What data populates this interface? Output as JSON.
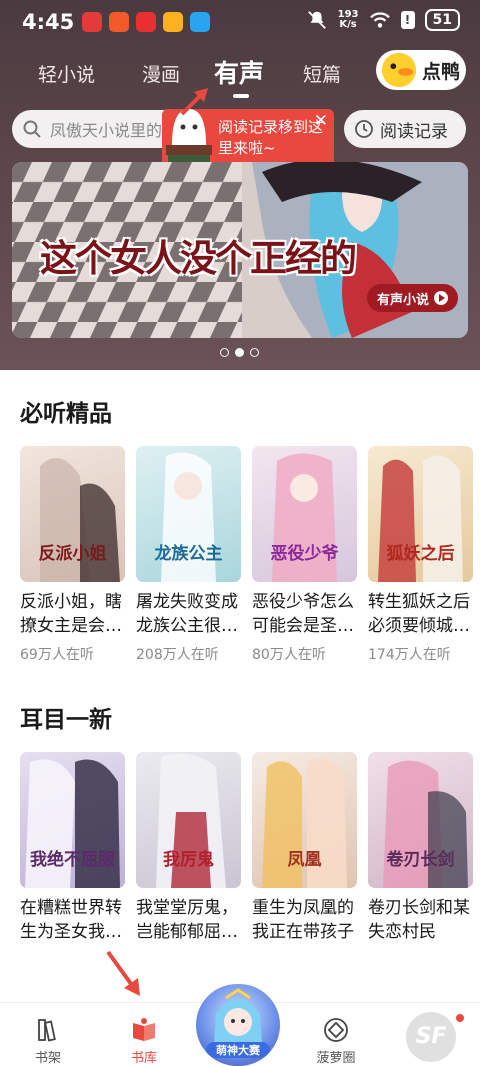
{
  "status_bar": {
    "time": "4:45",
    "net_speed_value": "193",
    "net_speed_unit": "K/s",
    "battery": "51"
  },
  "top_tabs": [
    {
      "label": "轻小说"
    },
    {
      "label": "漫画"
    },
    {
      "label": "有声",
      "active": true
    },
    {
      "label": "短篇"
    }
  ],
  "duck_button": {
    "label": "点鸭"
  },
  "search": {
    "placeholder": "凤傲天小说里的"
  },
  "history_button": {
    "label": "阅读记录"
  },
  "tooltip": {
    "text": "阅读记录移到这里来啦~"
  },
  "banner": {
    "title": "这个女人没个正经的",
    "tag": "有声小说",
    "slide_count": 3,
    "active_slide": 2
  },
  "section_featured": {
    "title": "必听精品",
    "items": [
      {
        "title": "反派小姐，瞎撩女主是会…",
        "listeners": "69万人在听",
        "cover_text": "反派小姐",
        "cover_color": "#e9ddd5"
      },
      {
        "title": "屠龙失败变成龙族公主很…",
        "listeners": "208万人在听",
        "cover_text": "龙族公主",
        "cover_color": "#cfe6ea"
      },
      {
        "title": "恶役少爷怎么可能会是圣…",
        "listeners": "80万人在听",
        "cover_text": "恶役少爷",
        "cover_color": "#e6d8e6"
      },
      {
        "title": "转生狐妖之后必须要倾城…",
        "listeners": "174万人在听",
        "cover_text": "狐妖之后",
        "cover_color": "#efe0c8"
      }
    ]
  },
  "section_new": {
    "title": "耳目一新",
    "items": [
      {
        "title": "在糟糕世界转生为圣女我…",
        "cover_text": "我绝不屈服",
        "cover_color": "#d9d2e8"
      },
      {
        "title": "我堂堂厉鬼，岂能郁郁屈…",
        "cover_text": "我厉鬼",
        "cover_color": "#e2dfe8"
      },
      {
        "title": "重生为凤凰的我正在带孩子",
        "cover_text": "凤凰",
        "cover_color": "#efe3da"
      },
      {
        "title": "卷刃长剑和某失恋村民",
        "cover_text": "卷刃长剑",
        "cover_color": "#e8d4e0"
      }
    ]
  },
  "bottom_nav": [
    {
      "label": "书架"
    },
    {
      "label": "书库",
      "active": true
    },
    {
      "label": "萌神大赛"
    },
    {
      "label": "菠萝圈"
    }
  ],
  "sf_logo": "SF",
  "colors": {
    "accent": "#e8483e",
    "hero_bg": "#4a3a40"
  }
}
